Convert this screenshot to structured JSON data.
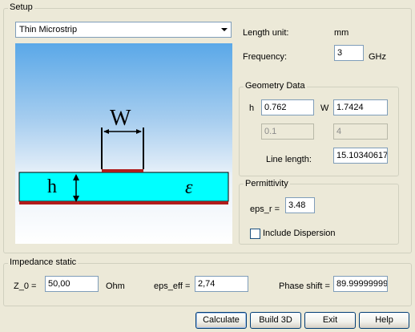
{
  "setup": {
    "title": "Setup",
    "line_type": "Thin Microstrip",
    "length_unit_label": "Length unit:",
    "length_unit_value": "mm",
    "frequency_label": "Frequency:",
    "frequency_value": "3",
    "frequency_unit": "GHz"
  },
  "diagram": {
    "width_symbol": "W",
    "height_symbol": "h",
    "permittivity_symbol": "ε",
    "colors": {
      "substrate": "#00ffff",
      "conductor": "#b01c1c"
    }
  },
  "geometry": {
    "title": "Geometry Data",
    "h_label": "h",
    "h_value": "0.762",
    "w_label": "W",
    "w_value": "1.7424",
    "disabled_1": "0.1",
    "disabled_2": "4",
    "line_length_label": "Line length:",
    "line_length_value": "15.10340617"
  },
  "permittivity": {
    "title": "Permittivity",
    "eps_r_label": "eps_r =",
    "eps_r_value": "3.48",
    "dispersion_label": "Include Dispersion",
    "dispersion_checked": false
  },
  "impedance": {
    "title": "Impedance static",
    "z0_label": "Z_0 =",
    "z0_value": "50,00",
    "z0_unit": "Ohm",
    "eps_eff_label": "eps_eff =",
    "eps_eff_value": "2,74",
    "phase_label": "Phase shift =",
    "phase_value": "89.99999999"
  },
  "buttons": {
    "calculate": "Calculate",
    "build3d": "Build 3D",
    "exit": "Exit",
    "help": "Help"
  }
}
